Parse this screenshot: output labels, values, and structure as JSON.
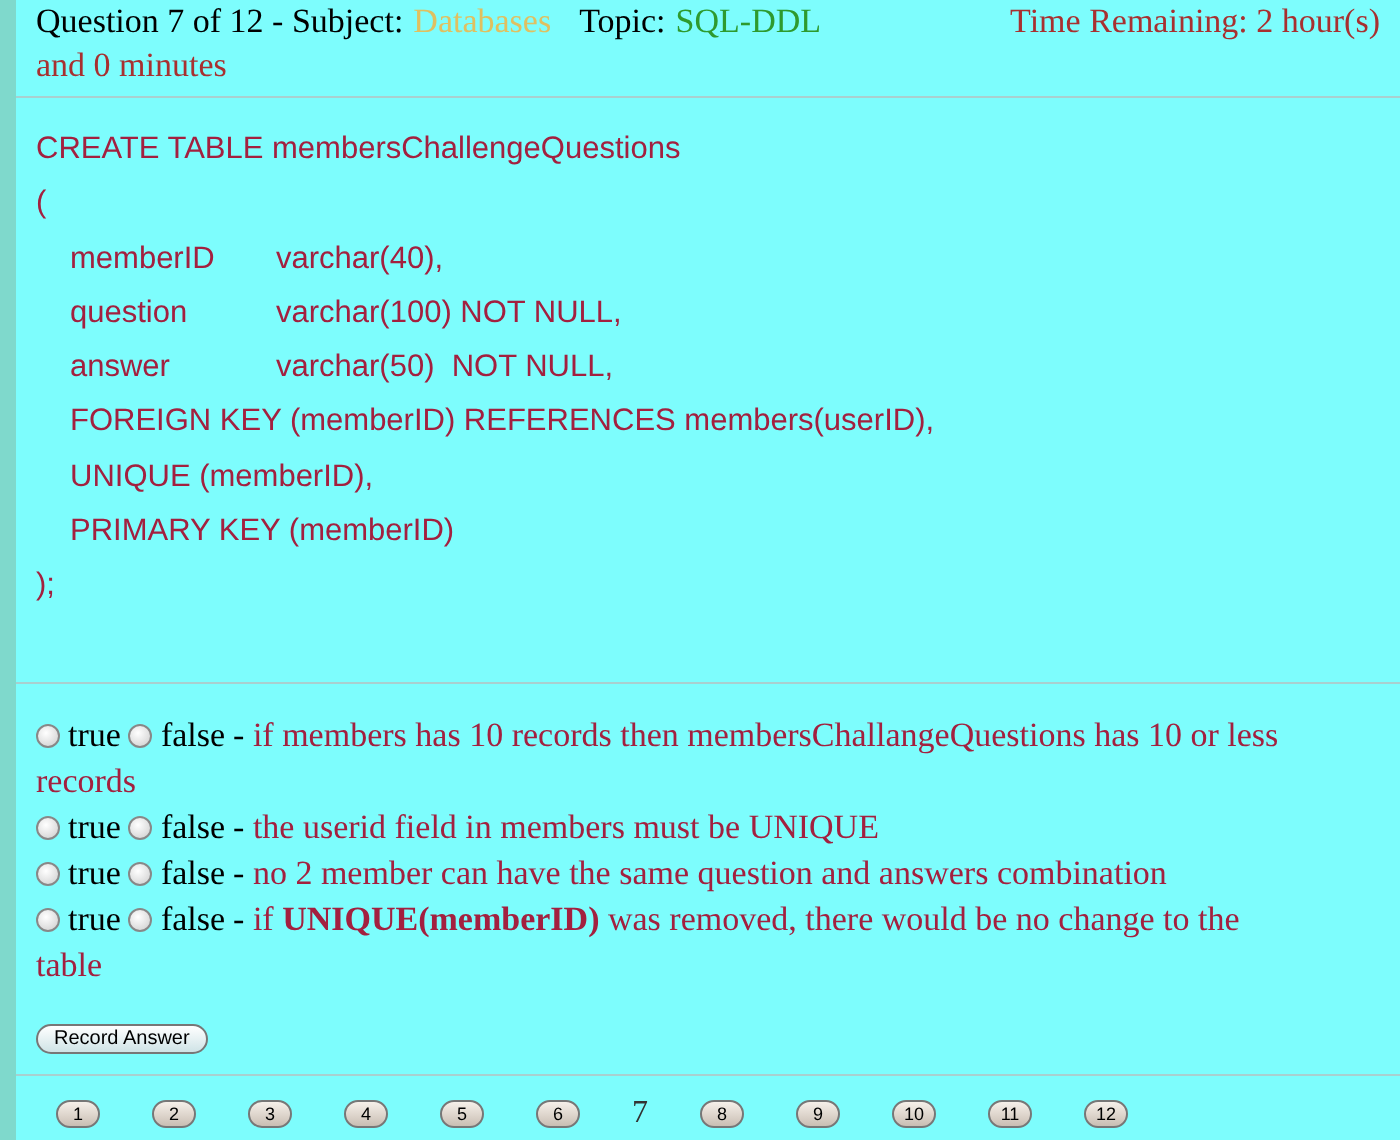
{
  "header": {
    "question": "Question 7 of 12 - Subject:",
    "subject": "Databases",
    "topic_label": "Topic:",
    "topic": "SQL-DDL",
    "time": "Time Remaining: 2 hour(s)",
    "time_continued": "and 0 minutes"
  },
  "code_lines": [
    {
      "indent": false,
      "text": "CREATE TABLE membersChallengeQuestions"
    },
    {
      "indent": false,
      "text": "("
    },
    {
      "indent": true,
      "cells": [
        "memberID",
        "varchar(40),"
      ]
    },
    {
      "indent": true,
      "cells": [
        "question",
        "varchar(100) NOT NULL,"
      ]
    },
    {
      "indent": true,
      "cells": [
        "answer",
        "varchar(50)  NOT NULL,"
      ]
    },
    {
      "indent": true,
      "text": "FOREIGN KEY (memberID) REFERENCES members(userID),"
    },
    {
      "indent": true,
      "text": "UNIQUE (memberID),"
    },
    {
      "indent": true,
      "text": "PRIMARY KEY (memberID)"
    },
    {
      "indent": false,
      "text": ");"
    }
  ],
  "statements": [
    {
      "options": [
        {
          "label": "true",
          "selected": false
        },
        {
          "label": "false",
          "selected": false
        }
      ],
      "separator": "-",
      "text_lines": [
        "if members has 10 records then membersChallangeQuestions has 10 or less",
        "records"
      ]
    },
    {
      "options": [
        {
          "label": "true",
          "selected": false
        },
        {
          "label": "false",
          "selected": false
        }
      ],
      "separator": "-",
      "text_lines": [
        "the userid field in members must be UNIQUE"
      ]
    },
    {
      "options": [
        {
          "label": "true",
          "selected": false
        },
        {
          "label": "false",
          "selected": false
        }
      ],
      "separator": "-",
      "text_lines": [
        "no 2 member can have the same question and answers combination"
      ]
    },
    {
      "options": [
        {
          "label": "true",
          "selected": false
        },
        {
          "label": "false",
          "selected": false
        }
      ],
      "separator": "-",
      "text_lines": [
        "if **UNIQUE(memberID)** was removed, there would be no change to the",
        "table"
      ]
    }
  ],
  "record_button": "Record Answer",
  "pages": [
    {
      "label": "1",
      "selected": false
    },
    {
      "label": "2",
      "selected": false
    },
    {
      "label": "3",
      "selected": false
    },
    {
      "label": "4",
      "selected": false
    },
    {
      "label": "5",
      "selected": false
    },
    {
      "label": "6",
      "selected": false
    },
    {
      "label": "7",
      "selected": true
    },
    {
      "label": "8",
      "selected": false
    },
    {
      "label": "9",
      "selected": false
    },
    {
      "label": "10",
      "selected": false
    },
    {
      "label": "11",
      "selected": false
    },
    {
      "label": "12",
      "selected": false
    }
  ]
}
